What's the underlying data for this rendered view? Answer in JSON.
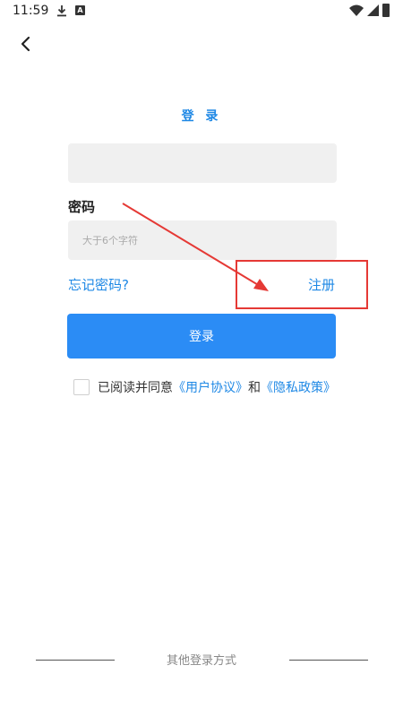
{
  "status_bar": {
    "time": "11:59",
    "download_icon": "download-icon",
    "a_icon_text": "A",
    "wifi_icon": "wifi-icon",
    "signal_icon": "signal-icon",
    "battery_icon": "battery-icon"
  },
  "header": {
    "back_icon": "chevron-left-icon",
    "title": "登 录"
  },
  "form": {
    "username_value": "",
    "password_label": "密码",
    "password_placeholder": "大于6个字符",
    "forgot_label": "忘记密码?",
    "register_label": "注册",
    "login_button_label": "登录"
  },
  "agreement": {
    "prefix": "已阅读并同意",
    "user_agreement": "《用户协议》",
    "conjunction": "和",
    "privacy_policy": "《隐私政策》",
    "checked": false
  },
  "footer": {
    "other_login_label": "其他登录方式"
  },
  "colors": {
    "accent": "#1e88e5",
    "button": "#2b8cf5",
    "annotation": "#e53935",
    "field_bg": "#f0f0f0"
  }
}
